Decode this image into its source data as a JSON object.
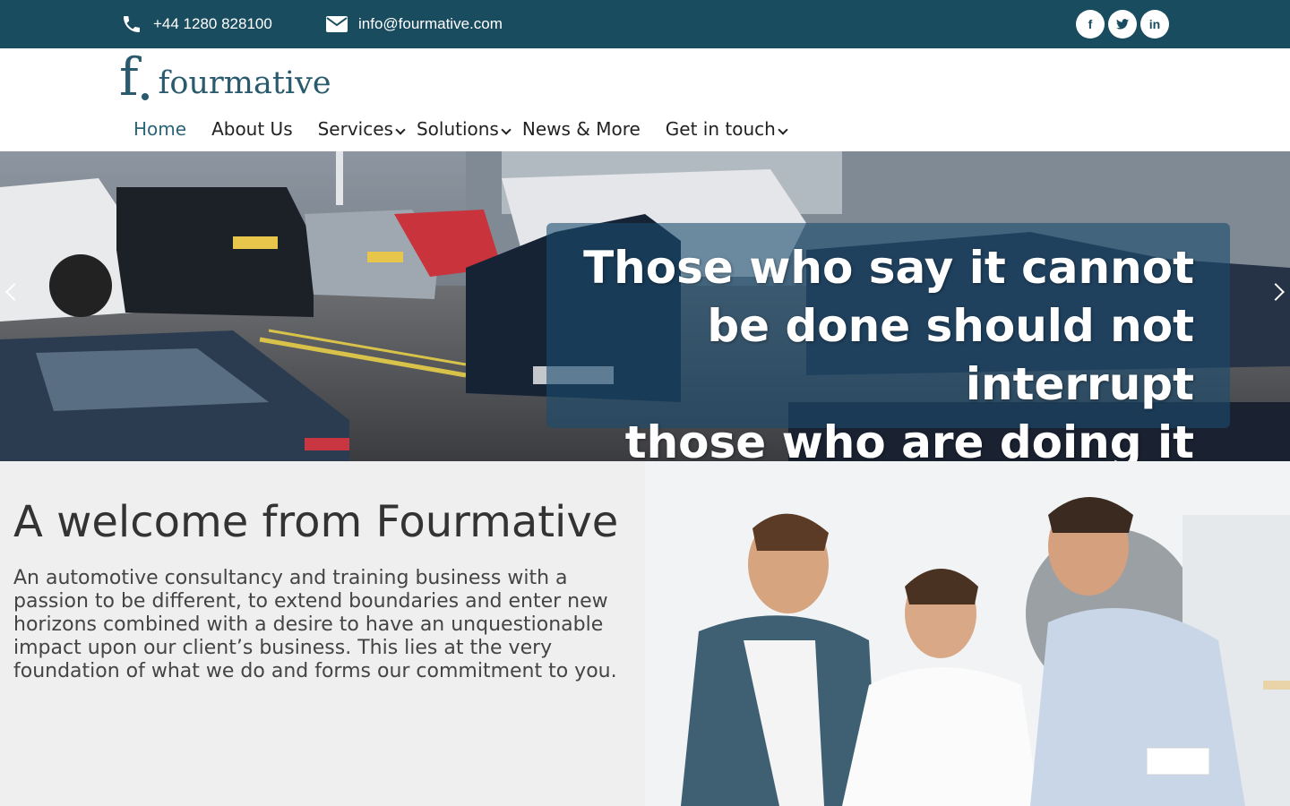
{
  "topbar": {
    "phone": "+44 1280 828100",
    "email": "info@fourmative.com",
    "social": [
      {
        "icon": "facebook-icon",
        "glyph": "f"
      },
      {
        "icon": "twitter-icon",
        "glyph": "t"
      },
      {
        "icon": "linkedin-icon",
        "glyph": "in"
      }
    ]
  },
  "logo": {
    "letter": "f",
    "word": "fourmative"
  },
  "nav": {
    "items": [
      {
        "label": "Home",
        "active": true
      },
      {
        "label": "About Us"
      },
      {
        "label": "Services",
        "dropdown": true
      },
      {
        "label": "Solutions",
        "dropdown": true
      },
      {
        "label": "News & More"
      },
      {
        "label": "Get in touch",
        "dropdown": true
      }
    ]
  },
  "hero": {
    "quote_lines": [
      "Those who say it cannot",
      "be done should not interrupt",
      "those who are doing it"
    ]
  },
  "welcome": {
    "title": "A welcome from Fourmative",
    "lines": [
      "An automotive consultancy and training business with a",
      "passion to be different, to extend boundaries and enter new",
      "horizons combined with a desire to have an unquestionable",
      "impact upon our client’s business. This lies at the very",
      "foundation of what we do and forms our commitment to you."
    ]
  },
  "colors": {
    "brand": "#1a4c5f",
    "accent": "#2a6478"
  }
}
